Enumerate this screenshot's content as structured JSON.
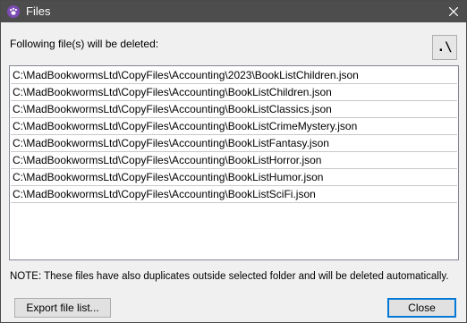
{
  "window": {
    "title": "Files",
    "accent": "#0078d7",
    "titlebar_color": "#4d4d4d"
  },
  "header": {
    "label": "Following file(s) will be deleted:",
    "path_button_label": ".\\"
  },
  "files": [
    "C:\\MadBookwormsLtd\\CopyFiles\\Accounting\\2023\\BookListChildren.json",
    "C:\\MadBookwormsLtd\\CopyFiles\\Accounting\\BookListChildren.json",
    "C:\\MadBookwormsLtd\\CopyFiles\\Accounting\\BookListClassics.json",
    "C:\\MadBookwormsLtd\\CopyFiles\\Accounting\\BookListCrimeMystery.json",
    "C:\\MadBookwormsLtd\\CopyFiles\\Accounting\\BookListFantasy.json",
    "C:\\MadBookwormsLtd\\CopyFiles\\Accounting\\BookListHorror.json",
    "C:\\MadBookwormsLtd\\CopyFiles\\Accounting\\BookListHumor.json",
    "C:\\MadBookwormsLtd\\CopyFiles\\Accounting\\BookListSciFi.json"
  ],
  "note": "NOTE: These files have also duplicates outside selected folder and will be deleted automatically.",
  "buttons": {
    "export_label": "Export file list...",
    "close_label": "Close"
  }
}
